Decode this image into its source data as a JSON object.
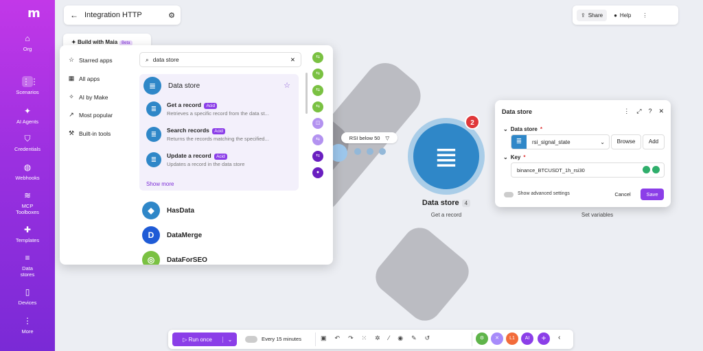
{
  "sidebar": {
    "logo": "m",
    "items": [
      {
        "label": "Org",
        "icon": "home-icon",
        "glyph": "⌂"
      },
      {
        "label": "Scenarios",
        "icon": "scenarios-icon",
        "glyph": "⋮⋮"
      },
      {
        "label": "AI Agents",
        "icon": "ai-agents-icon",
        "glyph": "✦"
      },
      {
        "label": "Credentials",
        "icon": "shield-icon",
        "glyph": "⛉"
      },
      {
        "label": "Webhooks",
        "icon": "globe-icon",
        "glyph": "◍"
      },
      {
        "label": "MCP Toolboxes",
        "icon": "wifi-icon",
        "glyph": "≋"
      },
      {
        "label": "Templates",
        "icon": "puzzle-icon",
        "glyph": "✚"
      },
      {
        "label": "Data stores",
        "icon": "database-icon",
        "glyph": "≡"
      },
      {
        "label": "Devices",
        "icon": "phone-icon",
        "glyph": "▯"
      },
      {
        "label": "More",
        "icon": "more-icon",
        "glyph": "⋮"
      }
    ]
  },
  "header": {
    "title": "Integration HTTP",
    "share_label": "Share",
    "help_label": "Help"
  },
  "maia": {
    "label": "Build with Maia",
    "badge": "Beta"
  },
  "picker": {
    "nav": [
      {
        "label": "Starred apps",
        "glyph": "☆"
      },
      {
        "label": "All apps",
        "glyph": "▦"
      },
      {
        "label": "AI by Make",
        "glyph": "✧"
      },
      {
        "label": "Most popular",
        "glyph": "↗"
      },
      {
        "label": "Built-in tools",
        "glyph": "⚒"
      }
    ],
    "search_value": "data store",
    "group_title": "Data store",
    "actions": [
      {
        "title": "Get a record",
        "badge": "Acid",
        "desc": "Retrieves a specific record from the data st..."
      },
      {
        "title": "Search records",
        "badge": "Acid",
        "desc": "Returns the records matching the specified..."
      },
      {
        "title": "Update a record",
        "badge": "Acid",
        "desc": "Updates a record in the data store"
      }
    ],
    "show_more": "Show more",
    "apps": [
      {
        "name": "HasData",
        "color": "#2f87c8"
      },
      {
        "name": "DataMerge",
        "color": "#1f5bd6"
      },
      {
        "name": "DataForSEO",
        "color": "#7ac142"
      }
    ]
  },
  "canvas": {
    "filter_label": "RSI below 50",
    "node_title": "Data store",
    "node_number": "4",
    "node_subtitle": "Get a record",
    "node_badge": "2",
    "next_node_subtitle": "Set variables"
  },
  "panel": {
    "title": "Data store",
    "datastore_label": "Data store",
    "datastore_value": "rsi_signal_state",
    "browse_label": "Browse",
    "add_label": "Add",
    "key_label": "Key",
    "key_value": "binance_BTCUSDT_1h_rsi30",
    "advanced_label": "Show advanced settings",
    "cancel_label": "Cancel",
    "save_label": "Save",
    "required_mark": "*"
  },
  "bottombar": {
    "run_label": "Run once",
    "schedule_label": "Every 15 minutes",
    "apps": [
      {
        "label": "⚙",
        "color": "#5fb44a"
      },
      {
        "label": "✕",
        "color": "#a78bfa"
      },
      {
        "label": "L1",
        "color": "#f26b3a"
      },
      {
        "label": "AI",
        "color": "#8b3ee8"
      }
    ]
  },
  "colors": {
    "accent": "#8b3ee8",
    "datastore": "#2f87c8",
    "badge_red": "#e0383a"
  }
}
